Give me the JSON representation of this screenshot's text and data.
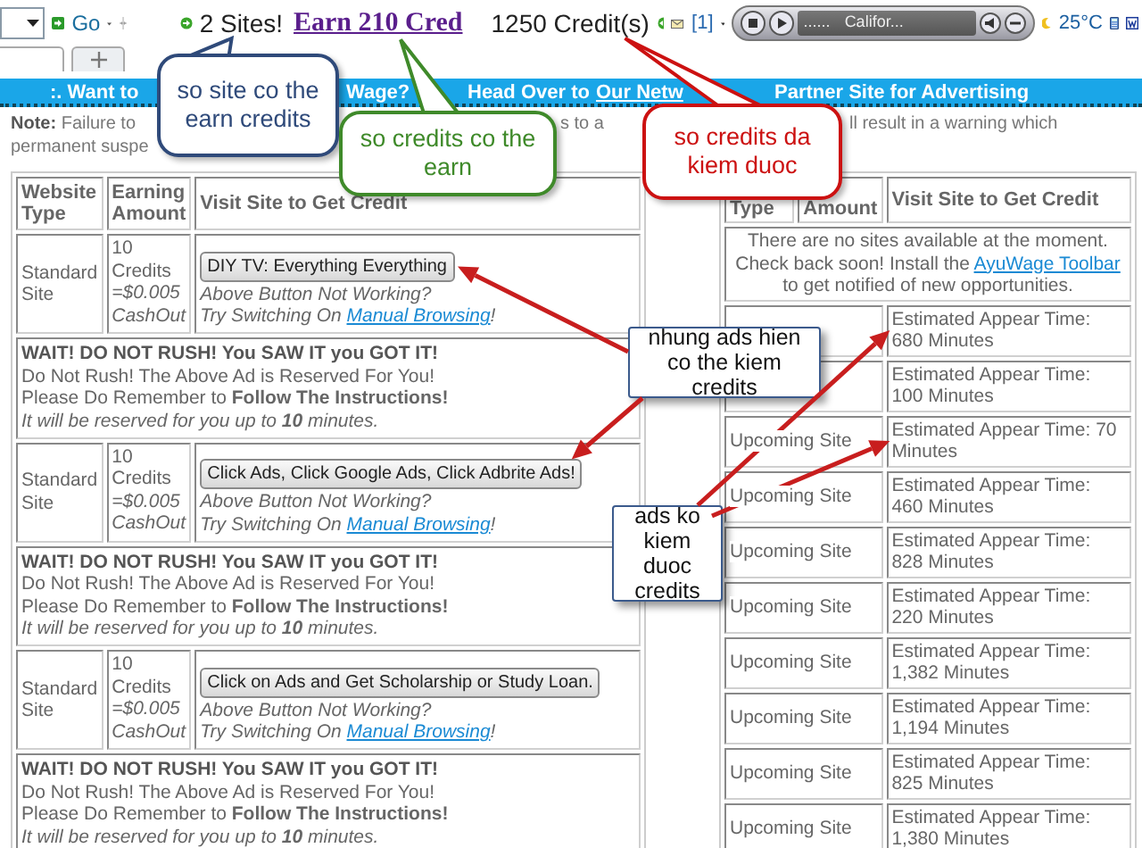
{
  "toolbar": {
    "go_label": "Go",
    "sites": "2 Sites!",
    "earn_link": "Earn 210 Cred",
    "credits": "1250 Credit(s)",
    "mail_count": "[1]",
    "player_dots": "......",
    "player_track": "Califor...",
    "temperature": "25°C"
  },
  "banner": {
    "fragments": [
      {
        "kind": "text",
        "text": ":. Want to"
      },
      {
        "kind": "text",
        "text": "Wage?"
      },
      {
        "kind": "text",
        "text": "Head Over to"
      },
      {
        "kind": "link",
        "text": "Our Netw"
      },
      {
        "kind": "text",
        "text": "Partner Site for Advertising"
      }
    ]
  },
  "note": {
    "fragments": [
      "**Note:** Failure to",
      "s to a",
      "ll result in a warning which",
      "permanent suspe"
    ]
  },
  "left_table": {
    "columns": [
      "Website Type",
      "Earning Amount",
      "Visit Site to Get Credit"
    ],
    "rows": [
      {
        "kind": "site",
        "type": "Standard Site",
        "amount": "10 Credits",
        "cashout": "=$0.005 CashOut",
        "button": "DIY TV: Everything Everything",
        "help": "Above Button Not Working?",
        "switch_text": "Try Switching On",
        "link": "Manual Browsing",
        "switch_end": "!"
      },
      {
        "kind": "notice",
        "title": "WAIT! DO NOT RUSH! You SAW IT you GOT IT!",
        "lines": [
          "Do Not Rush! The Above Ad is Reserved For You!",
          "Please Do Remember to **Follow The Instructions!**"
        ],
        "footer": "It will be reserved for you up to **10** minutes."
      },
      {
        "kind": "site",
        "type": "Standard Site",
        "amount": "10 Credits",
        "cashout": "=$0.005 CashOut",
        "button": "Click Ads, Click Google Ads, Click Adbrite Ads!",
        "help": "Above Button Not Working?",
        "switch_text": "Try Switching On",
        "link": "Manual Browsing",
        "switch_end": "!"
      },
      {
        "kind": "notice",
        "title": "WAIT! DO NOT RUSH! You SAW IT you GOT IT!",
        "lines": [
          "Do Not Rush! The Above Ad is Reserved For You!",
          "Please Do Remember to **Follow The Instructions!**"
        ],
        "footer": "It will be reserved for you up to **10** minutes."
      },
      {
        "kind": "site",
        "type": "Standard Site",
        "amount": "10 Credits",
        "cashout": "=$0.005 CashOut",
        "button": "Click on Ads and Get Scholarship or Study Loan.",
        "help": "Above Button Not Working?",
        "switch_text": "Try Switching On",
        "link": "Manual Browsing",
        "switch_end": "!"
      },
      {
        "kind": "notice",
        "title": "WAIT! DO NOT RUSH! You SAW IT you GOT IT!",
        "lines": [
          "Do Not Rush! The Above Ad is Reserved For You!",
          "Please Do Remember to **Follow The Instructions!**"
        ],
        "footer": "It will be reserved for you up to **10** minutes."
      }
    ]
  },
  "right_table": {
    "columns": [
      "Type",
      "Amount",
      "Visit Site to Get Credit"
    ],
    "message": {
      "before": "There are no sites available at the moment. Check back soon! Install the",
      "link": "AyuWage Toolbar",
      "after": "to get notified of new opportunities."
    },
    "rows": [
      {
        "time": "Estimated Appear Time: 680 Minutes"
      },
      {
        "time": "Estimated Appear Time: 100 Minutes"
      },
      {
        "site": "Upcoming Site",
        "time": "Estimated Appear Time: 70 Minutes"
      },
      {
        "site": "Upcoming Site",
        "time": "Estimated Appear Time: 460 Minutes"
      },
      {
        "site": "Upcoming Site",
        "time": "Estimated Appear Time: 828 Minutes"
      },
      {
        "site": "Upcoming Site",
        "time": "Estimated Appear Time: 220 Minutes"
      },
      {
        "site": "Upcoming Site",
        "time": "Estimated Appear Time: 1,382 Minutes"
      },
      {
        "site": "Upcoming Site",
        "time": "Estimated Appear Time: 1,194 Minutes"
      },
      {
        "site": "Upcoming Site",
        "time": "Estimated Appear Time: 825 Minutes"
      },
      {
        "site": "Upcoming Site",
        "time": "Estimated Appear Time: 1,380 Minutes"
      }
    ]
  },
  "annotations": [
    {
      "kind": "bubble",
      "text": "so site co the earn credits",
      "color": "#2f4a7a"
    },
    {
      "kind": "bubble",
      "text": "so credits co the earn",
      "color": "#3f8a2a"
    },
    {
      "kind": "bubble",
      "text": "so credits da kiem duoc",
      "color": "#cc1111"
    },
    {
      "kind": "box",
      "text": "nhung ads hien co the kiem credits",
      "color": "#3b5a8c"
    },
    {
      "kind": "box",
      "text": "ads ko kiem duoc credits",
      "color": "#3b5a8c"
    }
  ]
}
